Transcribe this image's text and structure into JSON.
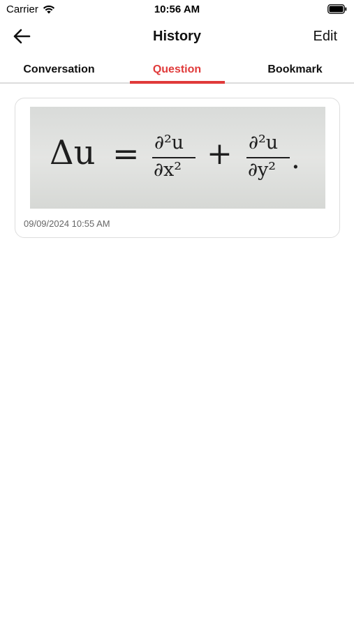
{
  "status_bar": {
    "carrier": "Carrier",
    "time": "10:56 AM"
  },
  "nav": {
    "title": "History",
    "edit_label": "Edit"
  },
  "tabs": [
    {
      "label": "Conversation",
      "active": false
    },
    {
      "label": "Question",
      "active": true
    },
    {
      "label": "Bookmark",
      "active": false
    }
  ],
  "colors": {
    "accent": "#e03a3a",
    "divider": "#dcdcdc"
  },
  "history": [
    {
      "formula": {
        "lhs": "Δu",
        "equals": "=",
        "term1_num": "∂²u",
        "term1_den": "∂x²",
        "plus": "+",
        "term2_num": "∂²u",
        "term2_den": "∂y²",
        "end": "."
      },
      "date": "09/09/2024 10:55 AM"
    }
  ]
}
